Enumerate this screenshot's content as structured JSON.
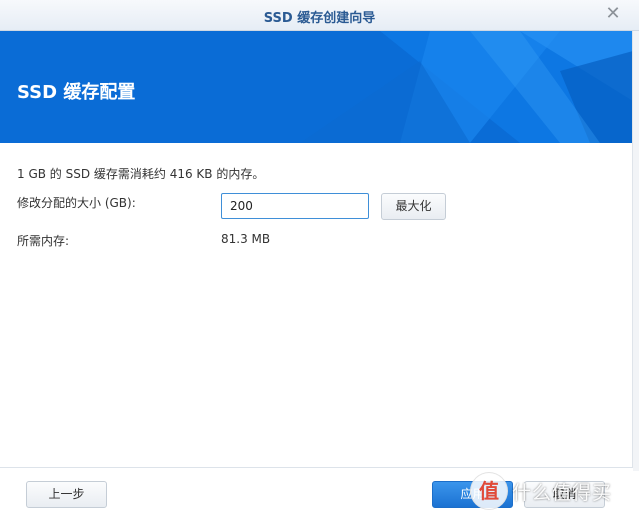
{
  "window": {
    "title": "SSD 缓存创建向导",
    "close_icon": "close-icon"
  },
  "banner": {
    "heading": "SSD 缓存配置",
    "color": "#0a6cd6"
  },
  "content": {
    "info_text": "1 GB 的 SSD 缓存需消耗约 416 KB 的内存。",
    "size_label": "修改分配的大小 (GB):",
    "size_value": "200",
    "max_button_label": "最大化",
    "memory_label": "所需内存:",
    "memory_value": "81.3 MB"
  },
  "footer": {
    "prev_label": "上一步",
    "apply_label": "应用",
    "cancel_label": "取消"
  },
  "watermark": {
    "badge_char": "值",
    "text": "什么值得买"
  }
}
